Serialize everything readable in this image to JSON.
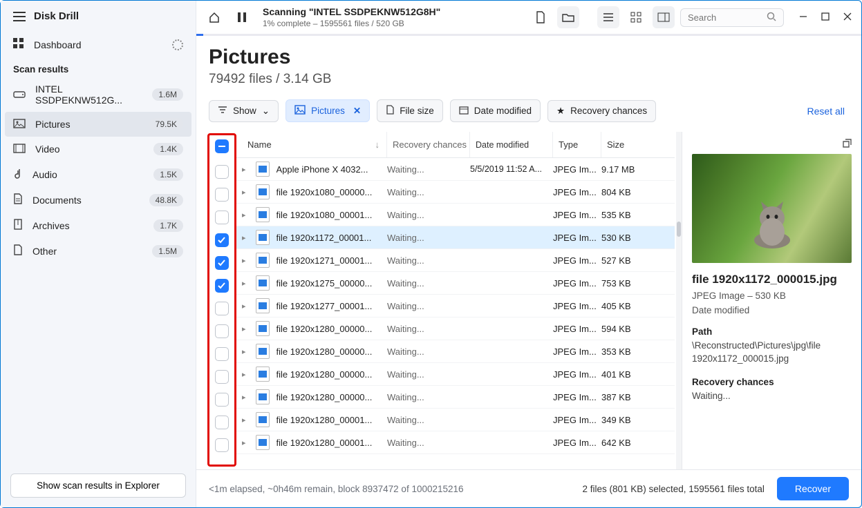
{
  "app": {
    "name": "Disk Drill"
  },
  "sidebar": {
    "dashboard": "Dashboard",
    "section": "Scan results",
    "items": [
      {
        "icon": "drive",
        "label": "INTEL SSDPEKNW512G...",
        "count": "1.6M"
      },
      {
        "icon": "picture",
        "label": "Pictures",
        "count": "79.5K",
        "active": true
      },
      {
        "icon": "video",
        "label": "Video",
        "count": "1.4K"
      },
      {
        "icon": "audio",
        "label": "Audio",
        "count": "1.5K"
      },
      {
        "icon": "document",
        "label": "Documents",
        "count": "48.8K"
      },
      {
        "icon": "archive",
        "label": "Archives",
        "count": "1.7K"
      },
      {
        "icon": "other",
        "label": "Other",
        "count": "1.5M"
      }
    ],
    "footer_btn": "Show scan results in Explorer"
  },
  "topbar": {
    "title": "Scanning \"INTEL SSDPEKNW512G8H\"",
    "subtitle": "1% complete – 1595561 files / 520 GB",
    "search_placeholder": "Search"
  },
  "page": {
    "title": "Pictures",
    "subtitle": "79492 files / 3.14 GB"
  },
  "filters": {
    "show": "Show",
    "pictures": "Pictures",
    "filesize": "File size",
    "datemod": "Date modified",
    "recovery": "Recovery chances",
    "reset": "Reset all"
  },
  "columns": {
    "name": "Name",
    "rc": "Recovery chances",
    "dm": "Date modified",
    "type": "Type",
    "size": "Size"
  },
  "rows": [
    {
      "checked": false,
      "name": "Apple iPhone X 4032...",
      "rc": "Waiting...",
      "dm": "5/5/2019 11:52 A...",
      "type": "JPEG Im...",
      "size": "9.17 MB"
    },
    {
      "checked": false,
      "name": "file 1920x1080_00000...",
      "rc": "Waiting...",
      "dm": "",
      "type": "JPEG Im...",
      "size": "804 KB"
    },
    {
      "checked": false,
      "name": "file 1920x1080_00001...",
      "rc": "Waiting...",
      "dm": "",
      "type": "JPEG Im...",
      "size": "535 KB"
    },
    {
      "checked": true,
      "selected": true,
      "name": "file 1920x1172_00001...",
      "rc": "Waiting...",
      "dm": "",
      "type": "JPEG Im...",
      "size": "530 KB"
    },
    {
      "checked": true,
      "name": "file 1920x1271_00001...",
      "rc": "Waiting...",
      "dm": "",
      "type": "JPEG Im...",
      "size": "527 KB"
    },
    {
      "checked": true,
      "name": "file 1920x1275_00000...",
      "rc": "Waiting...",
      "dm": "",
      "type": "JPEG Im...",
      "size": "753 KB"
    },
    {
      "checked": false,
      "name": "file 1920x1277_00001...",
      "rc": "Waiting...",
      "dm": "",
      "type": "JPEG Im...",
      "size": "405 KB"
    },
    {
      "checked": false,
      "name": "file 1920x1280_00000...",
      "rc": "Waiting...",
      "dm": "",
      "type": "JPEG Im...",
      "size": "594 KB"
    },
    {
      "checked": false,
      "name": "file 1920x1280_00000...",
      "rc": "Waiting...",
      "dm": "",
      "type": "JPEG Im...",
      "size": "353 KB"
    },
    {
      "checked": false,
      "name": "file 1920x1280_00000...",
      "rc": "Waiting...",
      "dm": "",
      "type": "JPEG Im...",
      "size": "401 KB"
    },
    {
      "checked": false,
      "name": "file 1920x1280_00000...",
      "rc": "Waiting...",
      "dm": "",
      "type": "JPEG Im...",
      "size": "387 KB"
    },
    {
      "checked": false,
      "name": "file 1920x1280_00001...",
      "rc": "Waiting...",
      "dm": "",
      "type": "JPEG Im...",
      "size": "349 KB"
    },
    {
      "checked": false,
      "name": "file 1920x1280_00001...",
      "rc": "Waiting...",
      "dm": "",
      "type": "JPEG Im...",
      "size": "642 KB"
    }
  ],
  "details": {
    "filename": "file 1920x1172_000015.jpg",
    "meta": "JPEG Image – 530 KB",
    "dm_label": "Date modified",
    "path_label": "Path",
    "path": "\\Reconstructed\\Pictures\\jpg\\file 1920x1172_000015.jpg",
    "rc_label": "Recovery chances",
    "rc": "Waiting..."
  },
  "footer": {
    "left": "<1m elapsed, ~0h46m remain, block 8937472 of 1000215216",
    "right": "2 files (801 KB) selected, 1595561 files total",
    "recover": "Recover"
  }
}
